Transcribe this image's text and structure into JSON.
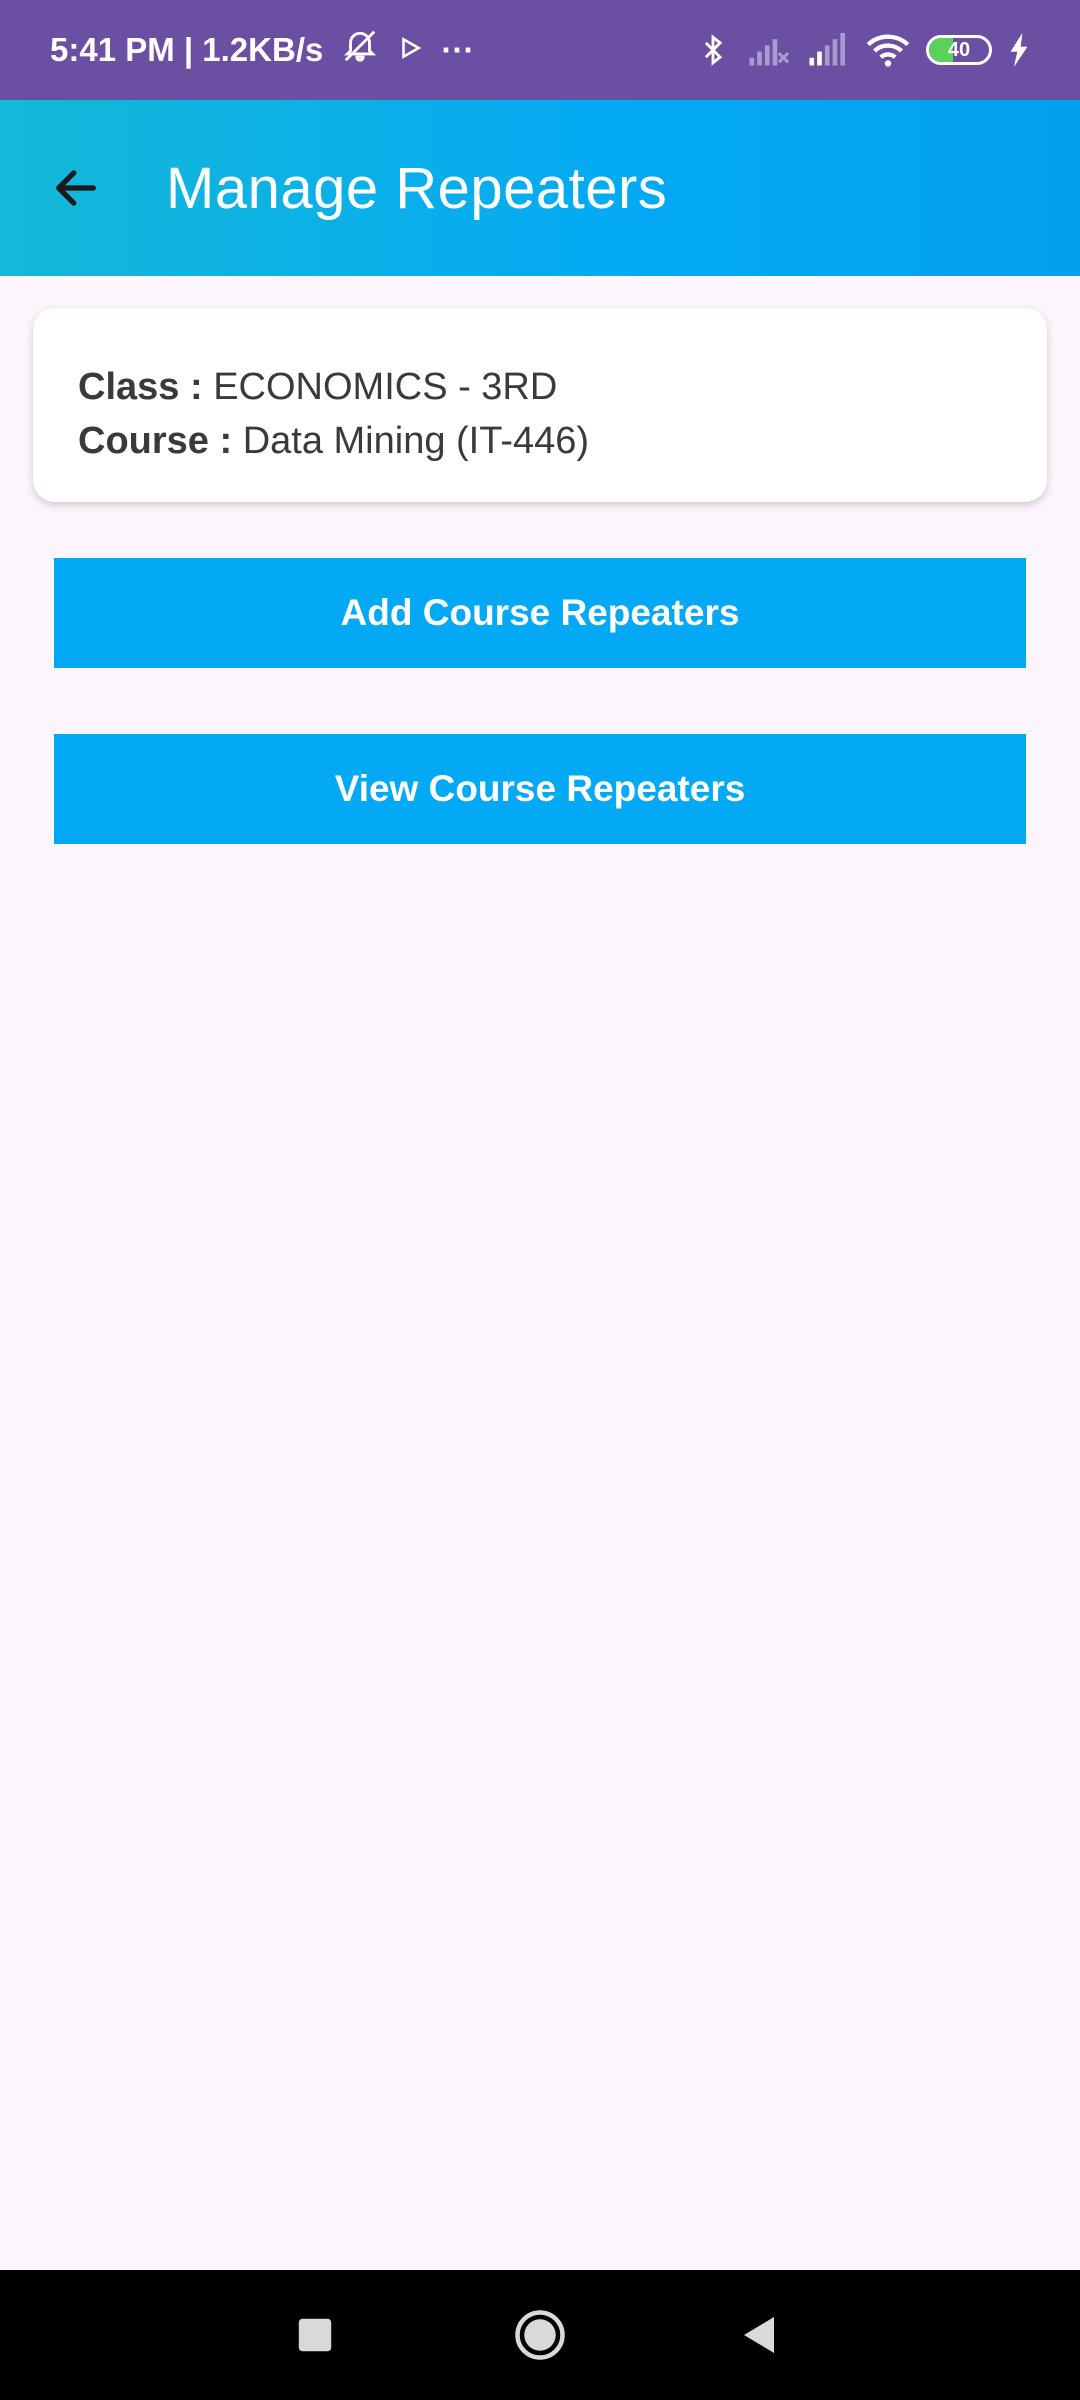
{
  "status_bar": {
    "time_speed": "5:41 PM | 1.2KB/s",
    "dots": "···",
    "battery_level": "40"
  },
  "app_bar": {
    "title": "Manage Repeaters"
  },
  "info_card": {
    "class_label": "Class :",
    "class_value": "ECONOMICS - 3RD",
    "course_label": "Course :",
    "course_value": "Data Mining (IT-446)"
  },
  "actions": {
    "add_label": "Add Course Repeaters",
    "view_label": "View Course Repeaters"
  },
  "colors": {
    "status_bar": "#6a4fa3",
    "accent": "#03a9f4",
    "background": "#fcf5fc"
  }
}
